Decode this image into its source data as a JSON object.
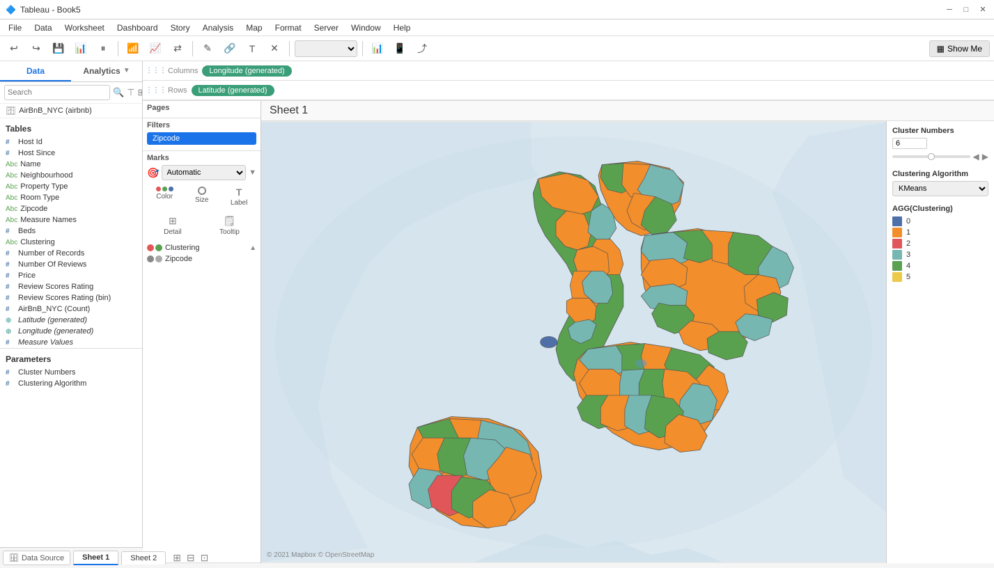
{
  "titleBar": {
    "title": "Tableau - Book5",
    "minimize": "─",
    "maximize": "□",
    "close": "✕"
  },
  "menuBar": {
    "items": [
      "File",
      "Data",
      "Worksheet",
      "Dashboard",
      "Story",
      "Analysis",
      "Map",
      "Format",
      "Server",
      "Window",
      "Help"
    ]
  },
  "toolbar": {
    "showMeLabel": "Show Me"
  },
  "leftPanel": {
    "tabs": [
      {
        "label": "Data",
        "active": true
      },
      {
        "label": "Analytics",
        "active": false
      }
    ],
    "dataSource": "AirBnB_NYC (airbnb)",
    "searchPlaceholder": "Search",
    "tablesTitle": "Tables",
    "fields": [
      {
        "icon": "#",
        "iconClass": "hash",
        "label": "Host Id",
        "italic": false
      },
      {
        "icon": "#",
        "iconClass": "hash",
        "label": "Host Since",
        "italic": false
      },
      {
        "icon": "Abc",
        "iconClass": "abc",
        "label": "Name",
        "italic": false
      },
      {
        "icon": "Abc",
        "iconClass": "abc",
        "label": "Neighbourhood",
        "italic": false
      },
      {
        "icon": "Abc",
        "iconClass": "abc",
        "label": "Property Type",
        "italic": false
      },
      {
        "icon": "Abc",
        "iconClass": "abc",
        "label": "Room Type",
        "italic": false
      },
      {
        "icon": "Abc",
        "iconClass": "abc",
        "label": "Zipcode",
        "italic": false
      },
      {
        "icon": "Abc",
        "iconClass": "abc",
        "label": "Measure Names",
        "italic": false
      },
      {
        "icon": "#",
        "iconClass": "hash",
        "label": "Beds",
        "italic": false
      },
      {
        "icon": "Abc",
        "iconClass": "abc",
        "label": "Clustering",
        "italic": false
      },
      {
        "icon": "#",
        "iconClass": "hash",
        "label": "Number of Records",
        "italic": false
      },
      {
        "icon": "#",
        "iconClass": "hash",
        "label": "Number Of Reviews",
        "italic": false
      },
      {
        "icon": "#",
        "iconClass": "hash",
        "label": "Price",
        "italic": false
      },
      {
        "icon": "#",
        "iconClass": "hash",
        "label": "Review Scores Rating",
        "italic": false
      },
      {
        "icon": "#",
        "iconClass": "hash",
        "label": "Review Scores Rating (bin)",
        "italic": false
      },
      {
        "icon": "#",
        "iconClass": "hash",
        "label": "AirBnB_NYC (Count)",
        "italic": false
      },
      {
        "icon": "⊕",
        "iconClass": "globe",
        "label": "Latitude (generated)",
        "italic": true
      },
      {
        "icon": "⊕",
        "iconClass": "globe",
        "label": "Longitude (generated)",
        "italic": true
      },
      {
        "icon": "#",
        "iconClass": "hash",
        "label": "Measure Values",
        "italic": true
      }
    ],
    "paramsTitle": "Parameters",
    "params": [
      {
        "icon": "#",
        "iconClass": "hash",
        "label": "Cluster Numbers"
      },
      {
        "icon": "#",
        "iconClass": "hash",
        "label": "Clustering Algorithm"
      }
    ]
  },
  "pages": {
    "title": "Pages"
  },
  "filters": {
    "title": "Filters",
    "items": [
      "Zipcode"
    ]
  },
  "marks": {
    "title": "Marks",
    "type": "Automatic",
    "buttons": [
      {
        "icon": "⬤⬤",
        "label": "Color"
      },
      {
        "icon": "◎",
        "label": "Size"
      },
      {
        "icon": "T",
        "label": "Label"
      },
      {
        "icon": "⊞",
        "label": "Detail"
      },
      {
        "icon": "⬜",
        "label": "Tooltip"
      }
    ],
    "fields": [
      {
        "label": "Clustering",
        "hasTriangle": true
      },
      {
        "label": "Zipcode"
      }
    ]
  },
  "columns": {
    "label": "Columns",
    "pill": "Longitude (generated)"
  },
  "rows": {
    "label": "Rows",
    "pill": "Latitude (generated)"
  },
  "sheet": {
    "title": "Sheet 1",
    "mapCredit": "© 2021 Mapbox © OpenStreetMap"
  },
  "legend": {
    "clusterNumbersLabel": "Cluster Numbers",
    "clusterNumbersValue": "6",
    "algorithmLabel": "Clustering Algorithm",
    "algorithmValue": "KMeans",
    "aggLabel": "AGG(Clustering)",
    "colors": [
      {
        "value": "0",
        "color": "#4e6fa8"
      },
      {
        "value": "1",
        "color": "#f28e2b"
      },
      {
        "value": "2",
        "color": "#e15759"
      },
      {
        "value": "3",
        "color": "#76b7b2"
      },
      {
        "value": "4",
        "color": "#59a14f"
      },
      {
        "value": "5",
        "color": "#edc949"
      }
    ]
  },
  "bottomBar": {
    "datasource": "Data Source",
    "tabs": [
      "Sheet 1",
      "Sheet 2"
    ]
  }
}
